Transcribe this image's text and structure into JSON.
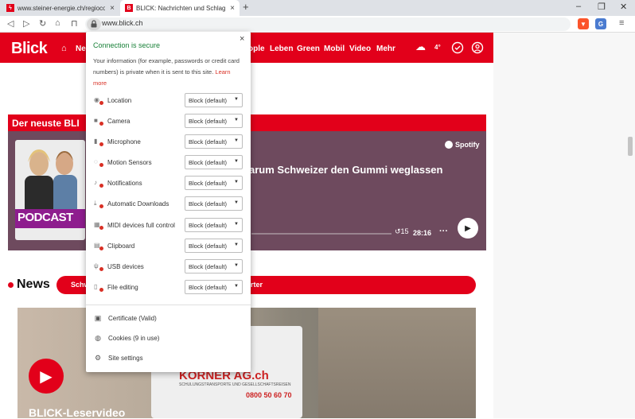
{
  "browser": {
    "tabs": [
      {
        "title": "www.steiner-energie.ch/regiocom",
        "favicon": "steiner-favicon",
        "active": false
      },
      {
        "title": "BLICK: Nachrichten und Schlagzeil",
        "favicon": "blick-favicon",
        "active": true
      }
    ],
    "new_tab_symbol": "+",
    "window_controls": {
      "minimize": "‒",
      "restore": "❐",
      "close": "✕"
    },
    "nav": {
      "back": "◁",
      "forward": "▷",
      "reload": "↻",
      "home": "⌂",
      "bookmark": "⊓"
    },
    "url": "www.blick.ch",
    "menu_symbol": "≡",
    "colors": {
      "tabbar": "#dee1e6",
      "accent_red": "#e2001a"
    }
  },
  "site": {
    "logo": "Blick",
    "nav": {
      "home_icon": "⌂",
      "partial_label": "Ne",
      "links": [
        "ople",
        "Leben",
        "Green",
        "Mobil",
        "Video",
        "Mehr"
      ],
      "weather_temp": "4°"
    },
    "podcast_section": {
      "header": "Der neuste BLI",
      "cover_label": "PODCAST",
      "episode_title": "arum Schweizer den Gummi weglassen",
      "provider": "Spotify",
      "skip": "15",
      "duration": "28:16",
      "more": "···"
    },
    "news": {
      "title": "News",
      "pill_left": "Schw",
      "pill_right": "rter"
    },
    "video": {
      "label": "BLICK-Leservideo",
      "bus_brand": "KORNER AG.ch",
      "bus_sub": "SCHULUNGSTRANSPORTE UND GESELLSCHAFTSREISEN",
      "bus_phone": "0800 50 60 70"
    }
  },
  "popup": {
    "close_symbol": "×",
    "title": "Connection is secure",
    "description": "Your information (for example, passwords or credit card numbers) is private when it is sent to this site.",
    "learn_more": "Learn more",
    "permissions": [
      {
        "label": "Location",
        "value": "Block (default)",
        "icon": "location-icon"
      },
      {
        "label": "Camera",
        "value": "Block (default)",
        "icon": "camera-icon"
      },
      {
        "label": "Microphone",
        "value": "Block (default)",
        "icon": "microphone-icon"
      },
      {
        "label": "Motion Sensors",
        "value": "Block (default)",
        "icon": "motion-sensor-icon"
      },
      {
        "label": "Notifications",
        "value": "Block (default)",
        "icon": "bell-icon"
      },
      {
        "label": "Automatic Downloads",
        "value": "Block (default)",
        "icon": "download-icon"
      },
      {
        "label": "MIDI devices full control",
        "value": "Block (default)",
        "icon": "midi-icon"
      },
      {
        "label": "Clipboard",
        "value": "Block (default)",
        "icon": "clipboard-icon"
      },
      {
        "label": "USB devices",
        "value": "Block (default)",
        "icon": "usb-icon"
      },
      {
        "label": "File editing",
        "value": "Block (default)",
        "icon": "file-icon"
      }
    ],
    "footer": [
      {
        "label": "Certificate (Valid)",
        "icon": "certificate-icon"
      },
      {
        "label": "Cookies (9 in use)",
        "icon": "cookie-icon"
      },
      {
        "label": "Site settings",
        "icon": "gear-icon"
      }
    ]
  }
}
